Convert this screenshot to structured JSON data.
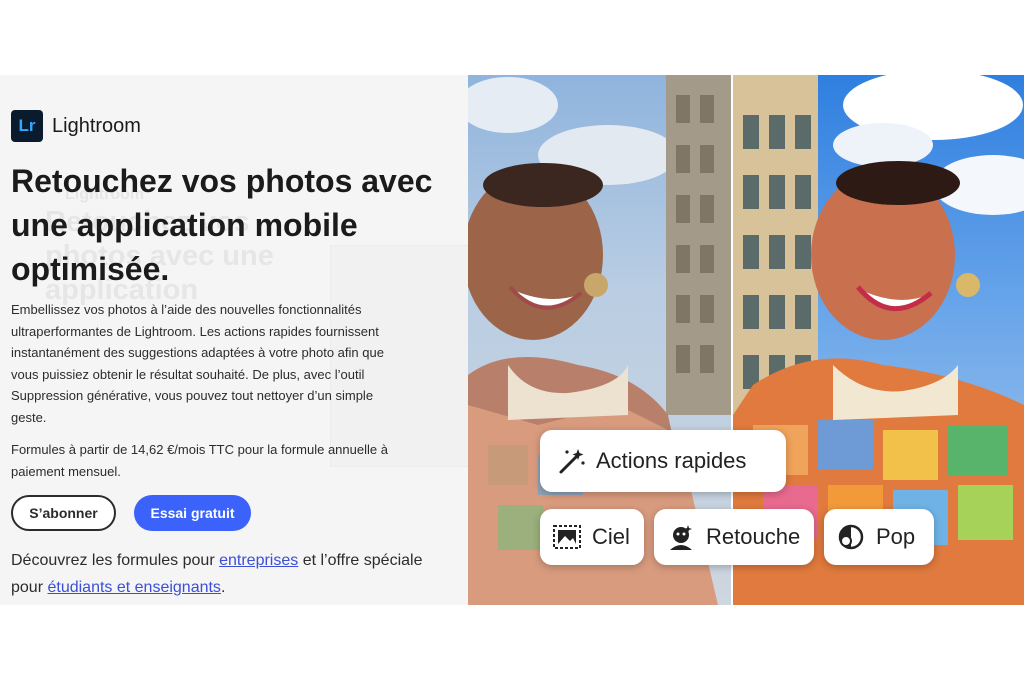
{
  "brand": {
    "logo_text": "Lr",
    "name": "Lightroom"
  },
  "hero": {
    "title": "Retouchez vos photos avec une application mobile optimisée.",
    "description": "Embellissez vos photos à l’aide des nouvelles fonctionnalités ultraperformantes de Lightroom. Les actions rapides fournissent instantanément des suggestions adaptées à votre photo afin que vous puissiez obtenir le résultat souhaité. De plus, avec l’outil Suppression générative, vous pouvez tout nettoyer d’un simple geste.",
    "price": "Formules à partir de 14,62 €/mois TTC pour la formule annuelle à paiement mensuel."
  },
  "buttons": {
    "subscribe": "S’abonner",
    "trial": "Essai gratuit"
  },
  "discover": {
    "prefix": "Découvrez les formules pour ",
    "link_business": "entreprises",
    "middle": " et l’offre spéciale pour ",
    "link_students": "étudiants et enseignants",
    "suffix": "."
  },
  "ghost": {
    "brand": "Lightroom",
    "title": "Retouchez vos photos avec une application"
  },
  "quick_actions": {
    "main": "Actions rapides",
    "sky": "Ciel",
    "retouch": "Retouche",
    "pop": "Pop"
  },
  "icons": {
    "magic": "magic-wand-icon",
    "sky": "sky-icon",
    "retouch": "retouch-face-icon",
    "pop": "pop-icon"
  },
  "colors": {
    "accent": "#3b63fb",
    "lr_logo_bg": "#0b1b2e",
    "lr_logo_text": "#31a8ff",
    "link": "#3b4fd8"
  }
}
